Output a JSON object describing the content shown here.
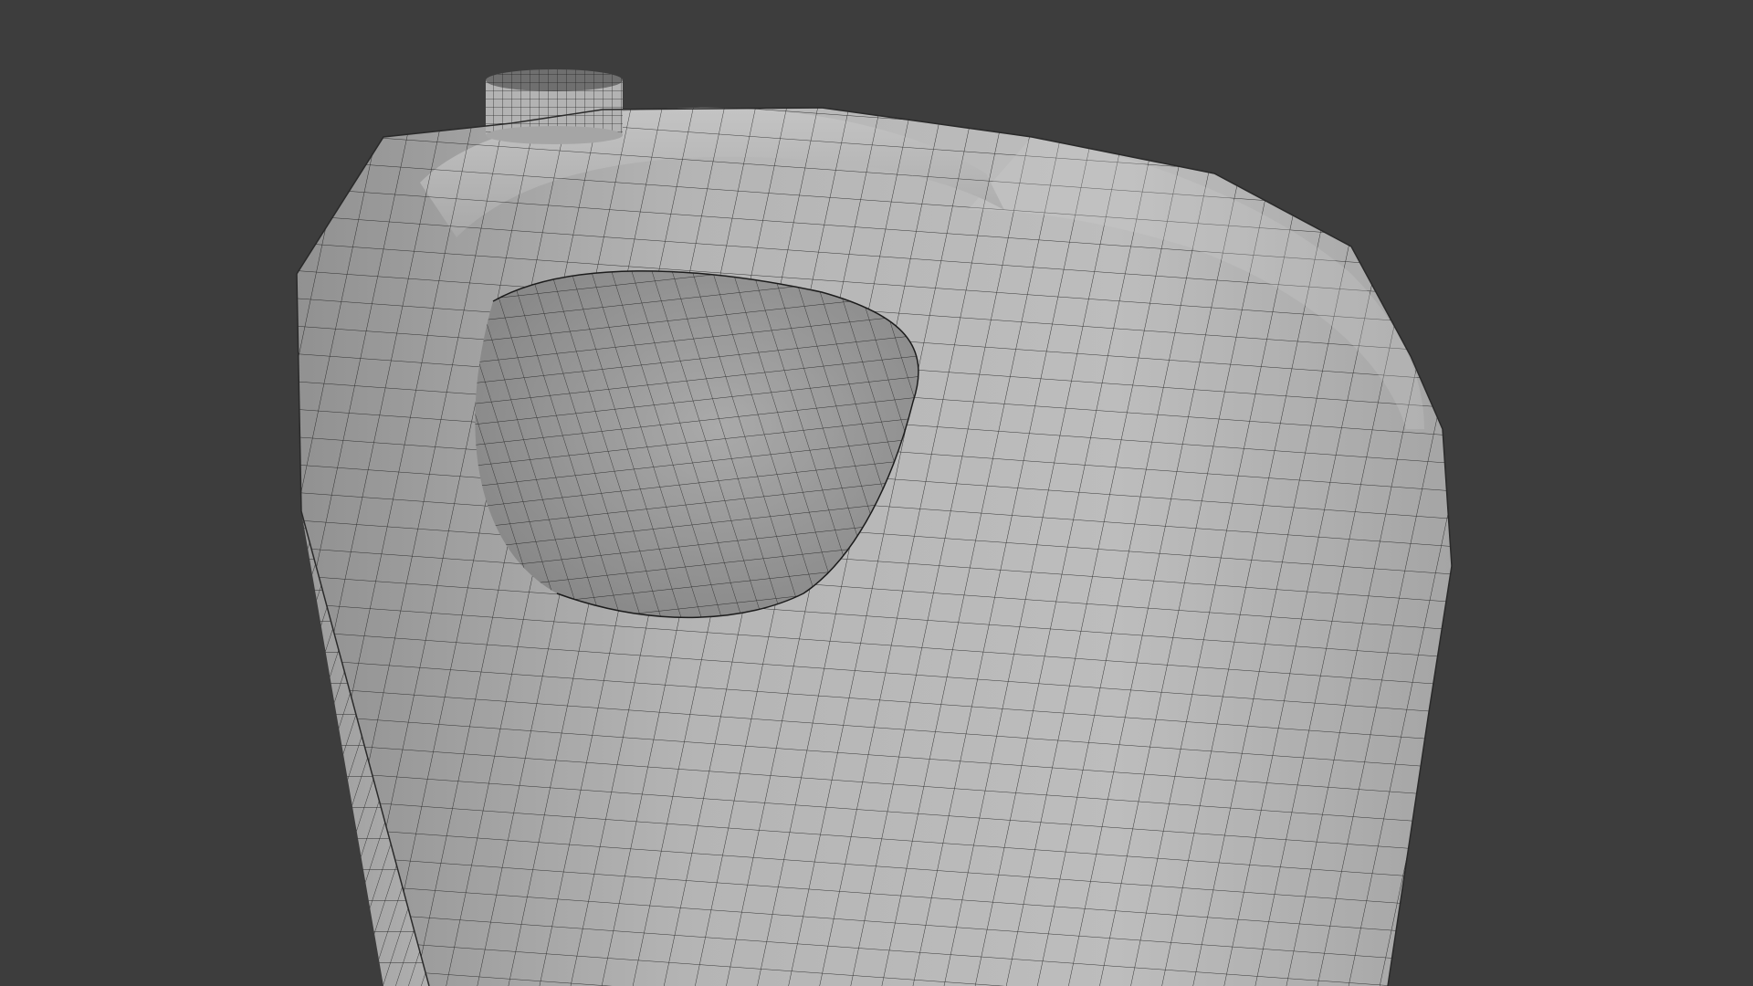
{
  "viewport": {
    "mode": "3d-viewport",
    "shading": "solid",
    "overlay": "wireframe",
    "object": "jerry-can-mesh",
    "colors": {
      "background": "#3d3d3d",
      "mesh_light": "#bdbdbd",
      "mesh_mid": "#9e9e9e",
      "mesh_dark": "#6f6f6f",
      "wire": "#1c1c1c"
    }
  }
}
